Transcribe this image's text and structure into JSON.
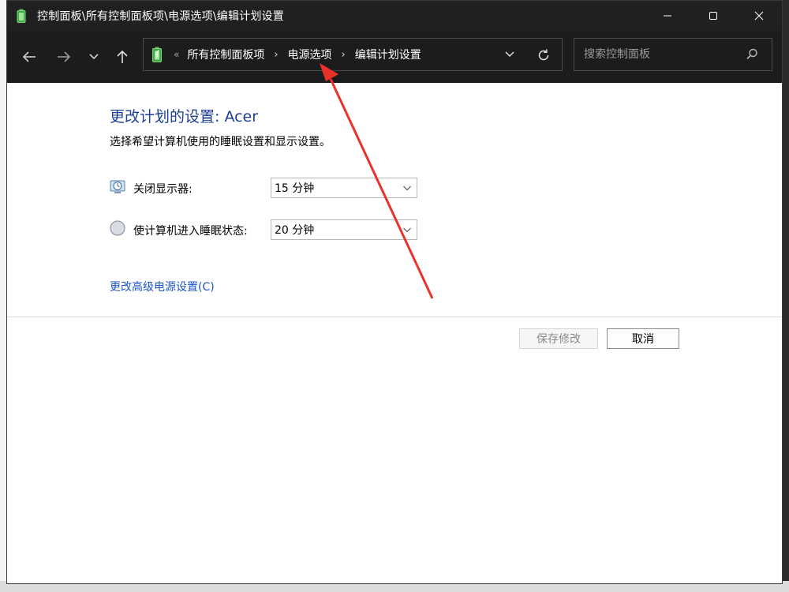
{
  "window": {
    "title": "控制面板\\所有控制面板项\\电源选项\\编辑计划设置"
  },
  "address_bar": {
    "overflow": "«",
    "crumbs": [
      "所有控制面板项",
      "电源选项",
      "编辑计划设置"
    ]
  },
  "search": {
    "placeholder": "搜索控制面板"
  },
  "main": {
    "heading": "更改计划的设置: Acer",
    "subtext": "选择希望计算机使用的睡眠设置和显示设置。",
    "settings": [
      {
        "label": "关闭显示器:",
        "value": "15 分钟",
        "icon": "display-clock-icon"
      },
      {
        "label": "使计算机进入睡眠状态:",
        "value": "20 分钟",
        "icon": "moon-icon"
      }
    ],
    "advanced_link": "更改高级电源设置(C)",
    "save_label": "保存修改",
    "cancel_label": "取消"
  },
  "colors": {
    "titlebar": "#202020",
    "navbar": "#1c1c1c",
    "heading": "#1e3f93",
    "link": "#1a56c8",
    "annotation_arrow": "#e8322a"
  },
  "icons": {
    "titlebar": "battery-icon",
    "back": "arrow-left-icon",
    "forward": "arrow-right-icon",
    "recent": "chevron-down-icon",
    "up": "arrow-up-icon",
    "refresh": "refresh-icon",
    "search": "search-icon",
    "minimize": "minimize-icon",
    "maximize": "maximize-icon",
    "close": "close-icon"
  }
}
